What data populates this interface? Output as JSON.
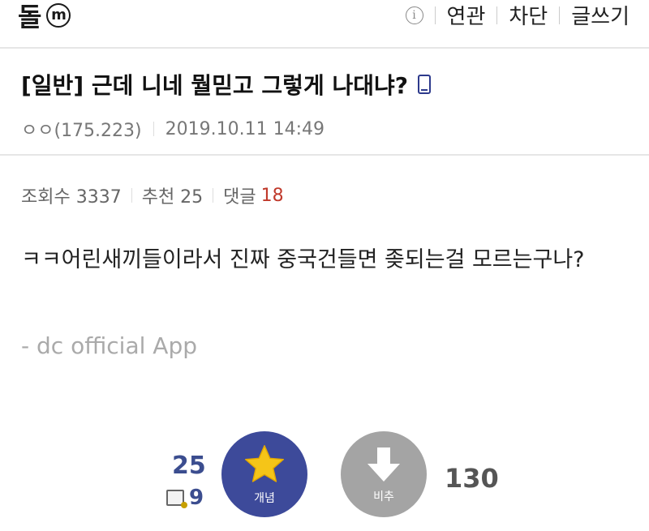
{
  "header": {
    "gallery_name": "돌",
    "badge": "m",
    "info_icon": "i",
    "actions": [
      "연관",
      "차단",
      "글쓰기"
    ]
  },
  "post": {
    "title": "[일반] 근데 니네 뭘믿고 그렇게 나대냐?",
    "author": "ㅇㅇ(175.223)",
    "date": "2019.10.11 14:49",
    "views_label": "조회수 3337",
    "recommend_label": "추천 25",
    "reply_label": "댓글",
    "reply_count": "18",
    "body": "ㅋㅋ어린새끼들이라서 진짜 중국건들면 좆되는걸 모르는구나?",
    "signature": "- dc official App"
  },
  "vote": {
    "up_count": "25",
    "fixed_count": "9",
    "up_label": "개념",
    "down_label": "비추",
    "down_count": "130"
  },
  "colors": {
    "accent": "#3d4a9a",
    "down_button": "#a4a4a4",
    "star": "#f5c518",
    "reply_count": "#c0392b"
  },
  "icons": [
    "info-icon",
    "mobile-phone-icon",
    "star-icon",
    "down-arrow-icon",
    "fixed-post-icon"
  ]
}
